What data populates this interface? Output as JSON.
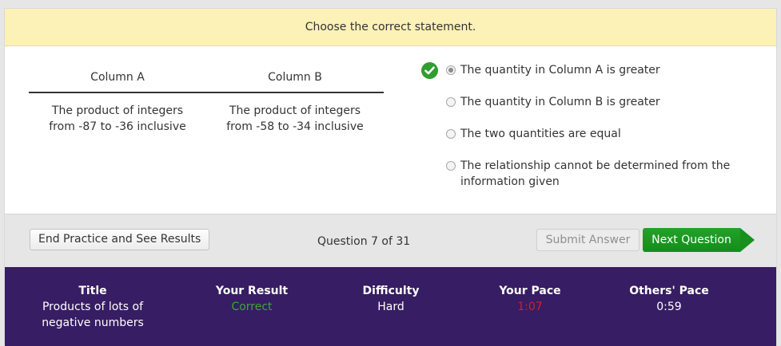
{
  "header": {
    "instruction": "Choose the correct statement."
  },
  "columns": {
    "a": {
      "heading": "Column A",
      "lines": [
        "The product of integers",
        "from -87 to -36 inclusive"
      ]
    },
    "b": {
      "heading": "Column B",
      "lines": [
        "The product of integers",
        "from -58 to -34 inclusive"
      ]
    }
  },
  "choices": [
    {
      "lines": [
        "The quantity in Column A is greater"
      ],
      "selected": true,
      "correct": true
    },
    {
      "lines": [
        "The quantity in Column B is greater"
      ],
      "selected": false
    },
    {
      "lines": [
        "The two quantities are equal"
      ],
      "selected": false
    },
    {
      "lines": [
        "The relationship cannot be determined from the",
        "information given"
      ],
      "selected": false
    }
  ],
  "toolbar": {
    "end_label": "End Practice and See Results",
    "question_count": "Question 7 of 31",
    "submit_label": "Submit Answer",
    "next_label": "Next Question"
  },
  "results": {
    "title": {
      "label": "Title",
      "lines": [
        "Products of lots of",
        "negative numbers"
      ]
    },
    "your_result": {
      "label": "Your Result",
      "value": "Correct"
    },
    "difficulty": {
      "label": "Difficulty",
      "value": "Hard"
    },
    "your_pace": {
      "label": "Your Pace",
      "value": "1:07"
    },
    "others_pace": {
      "label": "Others' Pace",
      "value": "0:59"
    }
  },
  "colors": {
    "header_bg": "#fcf1b6",
    "results_bg": "#371d63",
    "correct_green": "#3ca63c",
    "pace_red": "#d21e2e",
    "next_button": "#1a9622"
  },
  "icons": {
    "correct_marker": "check-circle-icon",
    "next_arrow": "arrow-right-icon"
  }
}
